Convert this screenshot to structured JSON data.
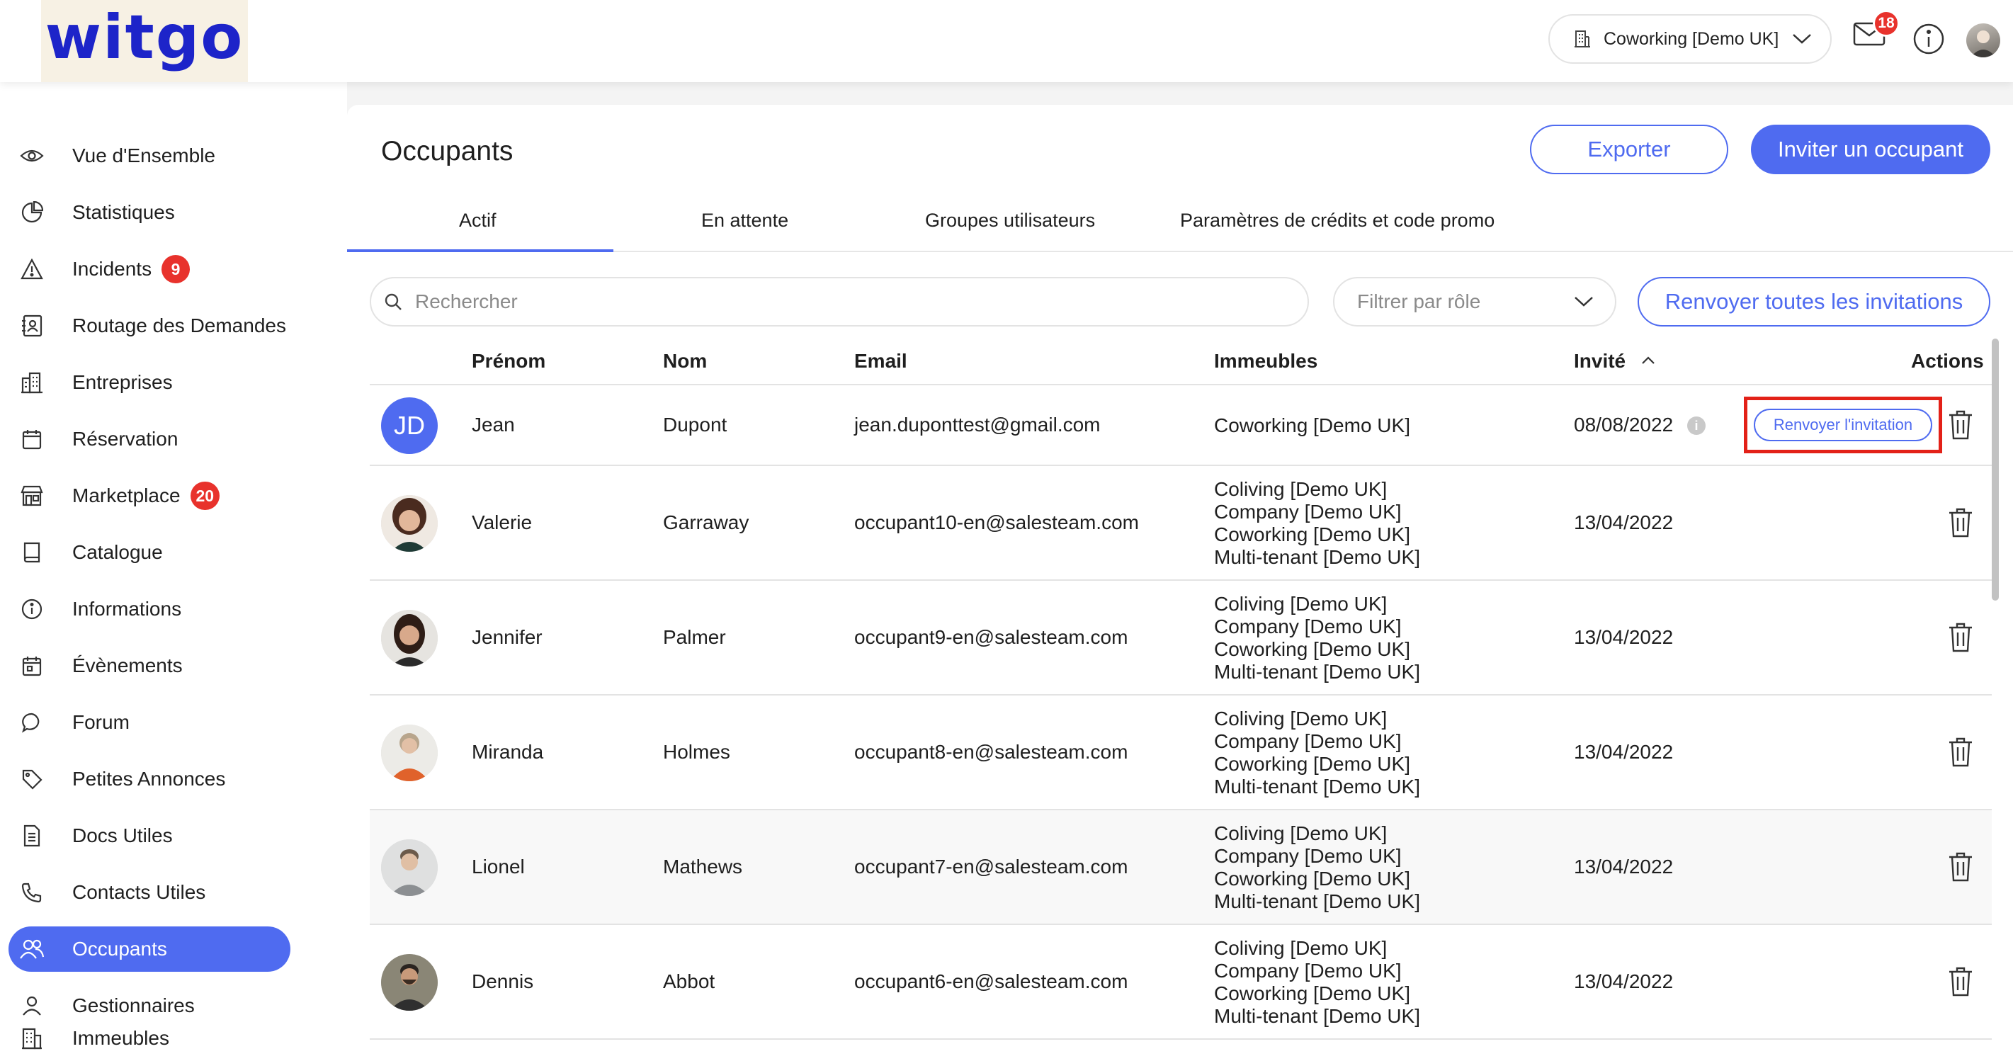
{
  "app": {
    "logo": "witgo"
  },
  "header": {
    "building_selector": "Coworking [Demo UK]",
    "mail_count": "18"
  },
  "sidebar": {
    "items": [
      {
        "label": "Vue d'Ensemble",
        "icon": "eye-icon"
      },
      {
        "label": "Statistiques",
        "icon": "pie-chart-icon"
      },
      {
        "label": "Incidents",
        "icon": "warning-icon",
        "badge": "9"
      },
      {
        "label": "Routage des Demandes",
        "icon": "contact-book-icon"
      },
      {
        "label": "Entreprises",
        "icon": "buildings-icon"
      },
      {
        "label": "Réservation",
        "icon": "calendar-icon"
      },
      {
        "label": "Marketplace",
        "icon": "store-icon",
        "badge": "20"
      },
      {
        "label": "Catalogue",
        "icon": "book-icon"
      },
      {
        "label": "Informations",
        "icon": "info-icon"
      },
      {
        "label": "Évènements",
        "icon": "calendar-event-icon"
      },
      {
        "label": "Forum",
        "icon": "chat-bubble-icon"
      },
      {
        "label": "Petites Annonces",
        "icon": "tag-icon"
      },
      {
        "label": "Docs Utiles",
        "icon": "document-icon"
      },
      {
        "label": "Contacts Utiles",
        "icon": "phone-icon"
      },
      {
        "label": "Occupants",
        "icon": "users-icon",
        "active": true
      },
      {
        "label": "Gestionnaires",
        "icon": "user-icon"
      },
      {
        "label": "Immeubles",
        "icon": "building-icon"
      }
    ]
  },
  "main": {
    "title": "Occupants",
    "export_label": "Exporter",
    "invite_label": "Inviter un occupant",
    "tabs": [
      {
        "label": "Actif",
        "active": true
      },
      {
        "label": "En attente"
      },
      {
        "label": "Groupes utilisateurs"
      },
      {
        "label": "Paramètres de crédits et code promo"
      }
    ],
    "search_placeholder": "Rechercher",
    "role_filter_placeholder": "Filtrer par rôle",
    "resend_all_label": "Renvoyer toutes les invitations",
    "resend_label": "Renvoyer l'invitation"
  },
  "table": {
    "headers": {
      "firstname": "Prénom",
      "lastname": "Nom",
      "email": "Email",
      "buildings": "Immeubles",
      "invited": "Invité",
      "actions": "Actions"
    },
    "rows": [
      {
        "initials": "JD",
        "firstname": "Jean",
        "lastname": "Dupont",
        "email": "jean.duponttest@gmail.com",
        "buildings": [
          "Coworking [Demo UK]"
        ],
        "invited": "08/08/2022"
      },
      {
        "firstname": "Valerie",
        "lastname": "Garraway",
        "email": "occupant10-en@salesteam.com",
        "buildings": [
          "Coliving [Demo UK]",
          "Company [Demo UK]",
          "Coworking [Demo UK]",
          "Multi-tenant [Demo UK]"
        ],
        "invited": "13/04/2022"
      },
      {
        "firstname": "Jennifer",
        "lastname": "Palmer",
        "email": "occupant9-en@salesteam.com",
        "buildings": [
          "Coliving [Demo UK]",
          "Company [Demo UK]",
          "Coworking [Demo UK]",
          "Multi-tenant [Demo UK]"
        ],
        "invited": "13/04/2022"
      },
      {
        "firstname": "Miranda",
        "lastname": "Holmes",
        "email": "occupant8-en@salesteam.com",
        "buildings": [
          "Coliving [Demo UK]",
          "Company [Demo UK]",
          "Coworking [Demo UK]",
          "Multi-tenant [Demo UK]"
        ],
        "invited": "13/04/2022"
      },
      {
        "firstname": "Lionel",
        "lastname": "Mathews",
        "email": "occupant7-en@salesteam.com",
        "buildings": [
          "Coliving [Demo UK]",
          "Company [Demo UK]",
          "Coworking [Demo UK]",
          "Multi-tenant [Demo UK]"
        ],
        "invited": "13/04/2022"
      },
      {
        "firstname": "Dennis",
        "lastname": "Abbot",
        "email": "occupant6-en@salesteam.com",
        "buildings": [
          "Coliving [Demo UK]",
          "Company [Demo UK]",
          "Coworking [Demo UK]",
          "Multi-tenant [Demo UK]"
        ],
        "invited": "13/04/2022"
      }
    ]
  },
  "colors": {
    "accent": "#4f6bf0",
    "badge": "#e8322c",
    "highlight": "#e32118",
    "logo": "#1d24c9"
  }
}
